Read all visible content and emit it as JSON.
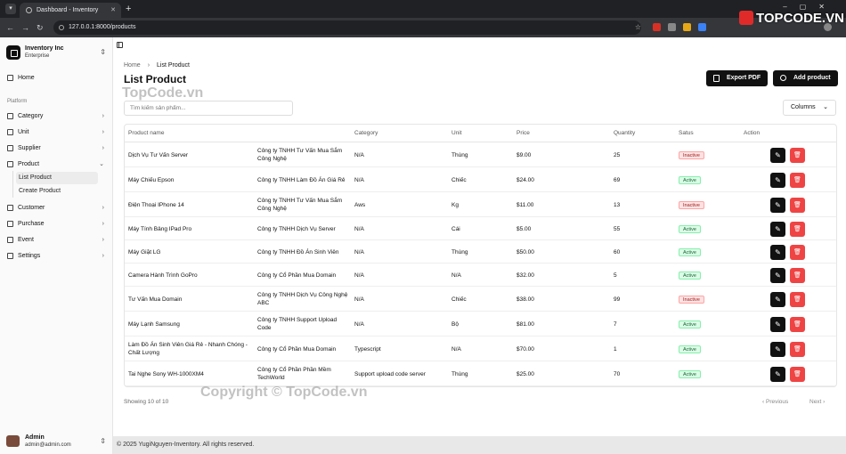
{
  "browser": {
    "tab_title": "Dashboard - Inventory",
    "url": "127.0.0.1:8000/products"
  },
  "watermark": {
    "brand": "TOPCODE.VN",
    "center": "TopCode.vn",
    "bottom": "Copyright © TopCode.vn"
  },
  "sidebar": {
    "org_name": "Inventory Inc",
    "org_plan": "Enterprise",
    "home": "Home",
    "section_label": "Platform",
    "items": [
      "Category",
      "Unit",
      "Supplier",
      "Product",
      "Customer",
      "Purchase",
      "Event",
      "Settings"
    ],
    "product_sub": [
      "List Product",
      "Create Product"
    ],
    "user_name": "Admin",
    "user_email": "admin@admin.com"
  },
  "main": {
    "breadcrumb": [
      "Home",
      "List Product"
    ],
    "title": "List Product",
    "export_pdf": "Export PDF",
    "add_product": "Add product",
    "search_placeholder": "Tìm kiếm sản phẩm...",
    "columns_label": "Columns",
    "table": {
      "headers": [
        "Product name",
        "",
        "Category",
        "Unit",
        "Price",
        "Quantity",
        "Satus",
        "Action"
      ],
      "rows": [
        {
          "name": "Dịch Vụ Tư Vấn Server",
          "supplier": "Công ty TNHH Tư Vấn Mua Sắm Công Nghệ",
          "category": "N/A",
          "unit": "Thùng",
          "price": "$9.00",
          "quantity": "25",
          "status": "Inactive"
        },
        {
          "name": "Máy Chiếu Epson",
          "supplier": "Công ty TNHH Làm Đồ Án Giá Rẻ",
          "category": "N/A",
          "unit": "Chiếc",
          "price": "$24.00",
          "quantity": "69",
          "status": "Active"
        },
        {
          "name": "Điện Thoại IPhone 14",
          "supplier": "Công ty TNHH Tư Vấn Mua Sắm Công Nghệ",
          "category": "Aws",
          "unit": "Kg",
          "price": "$11.00",
          "quantity": "13",
          "status": "Inactive"
        },
        {
          "name": "Máy Tính Bảng IPad Pro",
          "supplier": "Công ty TNHH Dịch Vụ Server",
          "category": "N/A",
          "unit": "Cái",
          "price": "$5.00",
          "quantity": "55",
          "status": "Active"
        },
        {
          "name": "Máy Giặt LG",
          "supplier": "Công ty TNHH Đồ Án Sinh Viên",
          "category": "N/A",
          "unit": "Thùng",
          "price": "$50.00",
          "quantity": "60",
          "status": "Active"
        },
        {
          "name": "Camera Hành Trình GoPro",
          "supplier": "Công ty Cổ Phần Mua Domain",
          "category": "N/A",
          "unit": "N/A",
          "price": "$32.00",
          "quantity": "5",
          "status": "Active"
        },
        {
          "name": "Tư Vấn Mua Domain",
          "supplier": "Công ty TNHH Dịch Vụ Công Nghệ ABC",
          "category": "N/A",
          "unit": "Chiếc",
          "price": "$38.00",
          "quantity": "99",
          "status": "Inactive"
        },
        {
          "name": "Máy Lạnh Samsung",
          "supplier": "Công ty TNHH Support Upload Code",
          "category": "N/A",
          "unit": "Bộ",
          "price": "$81.00",
          "quantity": "7",
          "status": "Active"
        },
        {
          "name": "Làm Đồ Án Sinh Viên Giá Rẻ - Nhanh Chóng - Chất Lượng",
          "supplier": "Công ty Cổ Phần Mua Domain",
          "category": "Typescript",
          "unit": "N/A",
          "price": "$70.00",
          "quantity": "1",
          "status": "Active"
        },
        {
          "name": "Tai Nghe Sony WH-1000XM4",
          "supplier": "Công ty Cổ Phần Phần Mềm TechWorld",
          "category": "Support upload code server",
          "unit": "Thùng",
          "price": "$25.00",
          "quantity": "70",
          "status": "Active"
        }
      ]
    },
    "showing": "Showing 10 of 10",
    "prev": "Previous",
    "next": "Next",
    "footer": "© 2025 YugiNguyen-Inventory. All rights reserved."
  },
  "icons": {
    "edit": "pencil-icon",
    "delete": "trash-icon"
  }
}
